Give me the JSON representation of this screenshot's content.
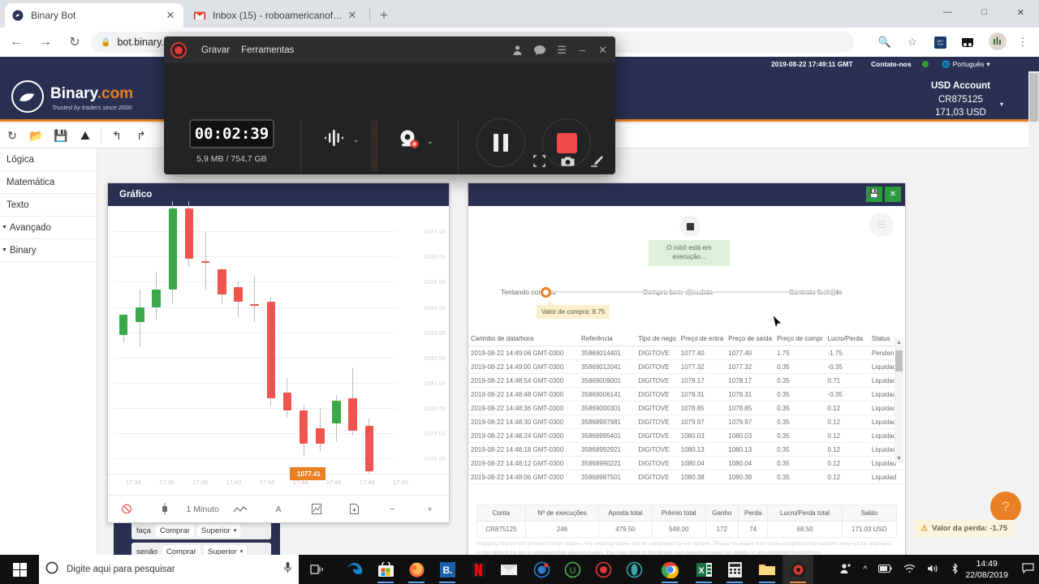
{
  "browser": {
    "tabs": [
      {
        "title": "Binary Bot",
        "favicon": "binary-icon",
        "active": true
      },
      {
        "title": "Inbox (15) - roboamericanofbi@",
        "favicon": "gmail-icon",
        "active": false
      }
    ],
    "new_tab_label": "+",
    "window_controls": {
      "minimize": "—",
      "maximize": "☐",
      "close": "✕"
    },
    "nav": {
      "back": "←",
      "forward": "→",
      "reload": "↻"
    },
    "omnibox": {
      "value": "bot.binary.com",
      "lock": "🔒"
    },
    "toolbar_icons": [
      "zoom-out-icon",
      "bookmark-star-icon",
      "extension-icon",
      "extension2-icon",
      "profile-avatar",
      "chrome-menu-icon"
    ]
  },
  "binary": {
    "topbar": {
      "time": "2019-08-22 17:49:11 GMT",
      "contact": "Contate-nos",
      "status_color": "#2e9e32",
      "language": "Português",
      "language_caret": "▾"
    },
    "brand": {
      "name": "Binary",
      "suffix": ".com",
      "tagline": "Trusted by traders since 2000"
    },
    "account": {
      "type": "USD Account",
      "id": "CR875125",
      "balance": "171,03 USD",
      "caret": "▾"
    },
    "toolstrip": [
      "reset-icon",
      "folder-open-icon",
      "save-icon",
      "google-drive-icon",
      "undo-icon",
      "redo-icon"
    ],
    "sidebar": {
      "items": [
        {
          "label": "Lógica",
          "expandable": false
        },
        {
          "label": "Matemática",
          "expandable": false
        },
        {
          "label": "Texto",
          "expandable": false
        },
        {
          "label": "Avançado",
          "expandable": true
        },
        {
          "label": "Binary",
          "expandable": true
        }
      ]
    },
    "blocks": [
      {
        "keyword": "faça",
        "action": "Comprar",
        "option": "Superior",
        "caret": "▾"
      },
      {
        "keyword": "senão",
        "action": "Comprar",
        "option": "Superior",
        "caret": "▾"
      }
    ]
  },
  "chart": {
    "tab_label": "Gráfico",
    "timeframe": "1 Minuto",
    "current_price": "1077.41",
    "footer_icons": [
      "no-chart-icon",
      "candle-icon",
      "line-style-icon",
      "text-tool-icon",
      "indicator-icon",
      "download-icon"
    ],
    "zoom_out": "−",
    "zoom_in": "+"
  },
  "chart_data": {
    "type": "candlestick",
    "title": "Gráfico",
    "xlabel": "",
    "ylabel": "",
    "ylim": [
      1077.4,
      1088.0
    ],
    "ytick_labels": [
      "1087.00",
      "1086.00",
      "1085.00",
      "1084.00",
      "1083.00",
      "1082.00",
      "1081.00",
      "1080.00",
      "1079.00",
      "1078.00"
    ],
    "xtick_labels": [
      "17:34",
      "17:36",
      "17:38",
      "17:40",
      "17:42",
      "17:44",
      "17:46",
      "17:48",
      "17:50"
    ],
    "current_price_marker": 1077.41,
    "candles": [
      {
        "t": "17:33",
        "o": 1082.9,
        "h": 1083.4,
        "l": 1082.6,
        "c": 1083.7,
        "dir": "up"
      },
      {
        "t": "17:34",
        "o": 1083.4,
        "h": 1084.7,
        "l": 1082.4,
        "c": 1084.0,
        "dir": "up"
      },
      {
        "t": "17:35",
        "o": 1084.0,
        "h": 1085.4,
        "l": 1083.5,
        "c": 1084.7,
        "dir": "up"
      },
      {
        "t": "17:36",
        "o": 1084.7,
        "h": 1088.2,
        "l": 1084.1,
        "c": 1087.9,
        "dir": "up"
      },
      {
        "t": "17:37",
        "o": 1087.9,
        "h": 1088.2,
        "l": 1085.6,
        "c": 1085.9,
        "dir": "down"
      },
      {
        "t": "17:38",
        "o": 1085.8,
        "h": 1087.0,
        "l": 1084.7,
        "c": 1085.8,
        "dir": "down"
      },
      {
        "t": "17:39",
        "o": 1085.5,
        "h": 1085.6,
        "l": 1084.1,
        "c": 1084.5,
        "dir": "down"
      },
      {
        "t": "17:40",
        "o": 1084.8,
        "h": 1085.0,
        "l": 1083.6,
        "c": 1084.2,
        "dir": "down"
      },
      {
        "t": "17:41",
        "o": 1084.1,
        "h": 1085.2,
        "l": 1083.4,
        "c": 1084.1,
        "dir": "down"
      },
      {
        "t": "17:42",
        "o": 1084.2,
        "h": 1084.4,
        "l": 1080.1,
        "c": 1080.4,
        "dir": "down"
      },
      {
        "t": "17:43",
        "o": 1080.6,
        "h": 1081.2,
        "l": 1079.6,
        "c": 1079.9,
        "dir": "down"
      },
      {
        "t": "17:44",
        "o": 1079.9,
        "h": 1080.1,
        "l": 1078.1,
        "c": 1078.6,
        "dir": "down"
      },
      {
        "t": "17:45",
        "o": 1078.6,
        "h": 1080.0,
        "l": 1078.3,
        "c": 1079.2,
        "dir": "down"
      },
      {
        "t": "17:46",
        "o": 1079.4,
        "h": 1080.5,
        "l": 1078.7,
        "c": 1080.3,
        "dir": "up"
      },
      {
        "t": "17:47",
        "o": 1080.4,
        "h": 1081.6,
        "l": 1078.9,
        "c": 1079.1,
        "dir": "down"
      },
      {
        "t": "17:48",
        "o": 1079.3,
        "h": 1079.6,
        "l": 1077.4,
        "c": 1077.5,
        "dir": "down"
      }
    ],
    "colors": {
      "up": "#3aa84b",
      "down": "#f0544f",
      "wick": "#b9bcc4",
      "marker": "#e98024"
    }
  },
  "run": {
    "save_icon": "save-icon",
    "close_icon": "close-icon",
    "stop_icon": "stop-square-icon",
    "list_icon": "list-icon",
    "toast": "O robô está em execução...",
    "steps": [
      {
        "label": "Tentando comprar",
        "state": "active"
      },
      {
        "label": "Compra bem-sucedida",
        "state": "pending"
      },
      {
        "label": "Contrato fechado",
        "state": "pending"
      }
    ],
    "tooltip": "Valor de compra: 8.75",
    "table": {
      "headers": [
        "Carimbo de data/hora",
        "Referência",
        "Tipo de nego",
        "Preço de entra",
        "Preço de saída",
        "Preço de compr",
        "Lucro/Perda",
        "Status"
      ],
      "rows": [
        {
          "cells": [
            "2019-08-22 14:49:06 GMT-0300",
            "35869014401",
            "DIGITOVE",
            "1077.40",
            "1077.40",
            "1.75",
            "-1.75",
            "Penden"
          ],
          "pl": "neg"
        },
        {
          "cells": [
            "2019-08-22 14:49:00 GMT-0300",
            "35869012041",
            "DIGITOVE",
            "1077.32",
            "1077.32",
            "0.35",
            "-0.35",
            "Liquidad"
          ],
          "pl": "neg"
        },
        {
          "cells": [
            "2019-08-22 14:48:54 GMT-0300",
            "35869009001",
            "DIGITOVE",
            "1078.17",
            "1078.17",
            "0.35",
            "0.71",
            "Liquidad"
          ],
          "pl": "pos"
        },
        {
          "cells": [
            "2019-08-22 14:48:48 GMT-0300",
            "35869006141",
            "DIGITOVE",
            "1078.31",
            "1078.31",
            "0.35",
            "-0.35",
            "Liquidad"
          ],
          "pl": "neg"
        },
        {
          "cells": [
            "2019-08-22 14:48:36 GMT-0300",
            "35869000301",
            "DIGITOVE",
            "1078.85",
            "1078.85",
            "0.35",
            "0.12",
            "Liquidad"
          ],
          "pl": "pos"
        },
        {
          "cells": [
            "2019-08-22 14:48:30 GMT-0300",
            "35868997981",
            "DIGITOVE",
            "1079.97",
            "1079.97",
            "0.35",
            "0.12",
            "Liquidad"
          ],
          "pl": "pos"
        },
        {
          "cells": [
            "2019-08-22 14:48:24 GMT-0300",
            "35868995401",
            "DIGITOVE",
            "1080.03",
            "1080.03",
            "0.35",
            "0.12",
            "Liquidad"
          ],
          "pl": "pos"
        },
        {
          "cells": [
            "2019-08-22 14:48:18 GMT-0300",
            "35868992921",
            "DIGITOVE",
            "1080.13",
            "1080.13",
            "0.35",
            "0.12",
            "Liquidad"
          ],
          "pl": "pos"
        },
        {
          "cells": [
            "2019-08-22 14:48:12 GMT-0300",
            "35868990221",
            "DIGITOVE",
            "1080.04",
            "1080.04",
            "0.35",
            "0.12",
            "Liquidad"
          ],
          "pl": "pos"
        },
        {
          "cells": [
            "2019-08-22 14:48:06 GMT-0300",
            "35868987501",
            "DIGITOVE",
            "1080.38",
            "1080.38",
            "0.35",
            "0.12",
            "Liquidad"
          ],
          "pl": "pos"
        }
      ]
    },
    "summary": {
      "headers": [
        "Conta",
        "Nº de execuções",
        "Aposta total",
        "Prêmio total",
        "Ganho",
        "Perda",
        "Lucro/Perda total",
        "Saldo"
      ],
      "row": [
        "CR875125",
        "246",
        "479.50",
        "548.00",
        "172",
        "74",
        "68.50",
        "171.03 USD"
      ]
    },
    "disclaimer": "Stopping the bot will prevent further trades. Any ongoing trades will be completed by our system. Please be aware that some completed transactions may not be displayed in the table if the bot is stopped while placing trades. You may refer to the Binary.com statement page for details of all completed transactions.",
    "help_icon": "question-mark-icon",
    "loss_toast": {
      "icon": "warning-icon",
      "text": "Valor da perda: -1.75"
    }
  },
  "recorder": {
    "title_menus": [
      "Gravar",
      "Ferramentas"
    ],
    "title_icons": [
      "account-icon",
      "chat-icon",
      "hamburger-menu-icon"
    ],
    "window_controls": {
      "minimize": "–",
      "close": "✕"
    },
    "timer": "00:02:39",
    "size": "5,9 MB / 754,7 GB",
    "audio_icon": "audio-waveform-icon",
    "webcam_icon": "webcam-disabled-icon",
    "caret": "⌄",
    "pause_label": "pause-button",
    "stop_label": "stop-button",
    "footer_icons": [
      "minimize-panel-icon",
      "screenshot-camera-icon",
      "draw-pen-icon"
    ]
  },
  "taskbar": {
    "start_icon": "windows-start-icon",
    "search_placeholder": "Digite aqui para pesquisar",
    "search_circle_icon": "cortana-circle-icon",
    "mic_icon": "microphone-icon",
    "taskview_icon": "task-view-icon",
    "apps": [
      "edge-icon",
      "microsoft-store-icon",
      "firefox-icon",
      "bitdefender-icon",
      "netflix-icon",
      "mail-icon",
      "app7-icon",
      "app8-icon",
      "app9-icon",
      "opera-icon",
      "chrome-icon",
      "excel-icon",
      "calculator-icon",
      "file-explorer-icon",
      "recorder-icon"
    ],
    "tray": [
      "people-icon",
      "show-hidden-icon",
      "battery-icon",
      "wifi-icon",
      "volume-icon",
      "bluetooth-icon"
    ],
    "clock": {
      "time": "14:49",
      "date": "22/08/2019"
    },
    "notification_icon": "notification-icon"
  }
}
